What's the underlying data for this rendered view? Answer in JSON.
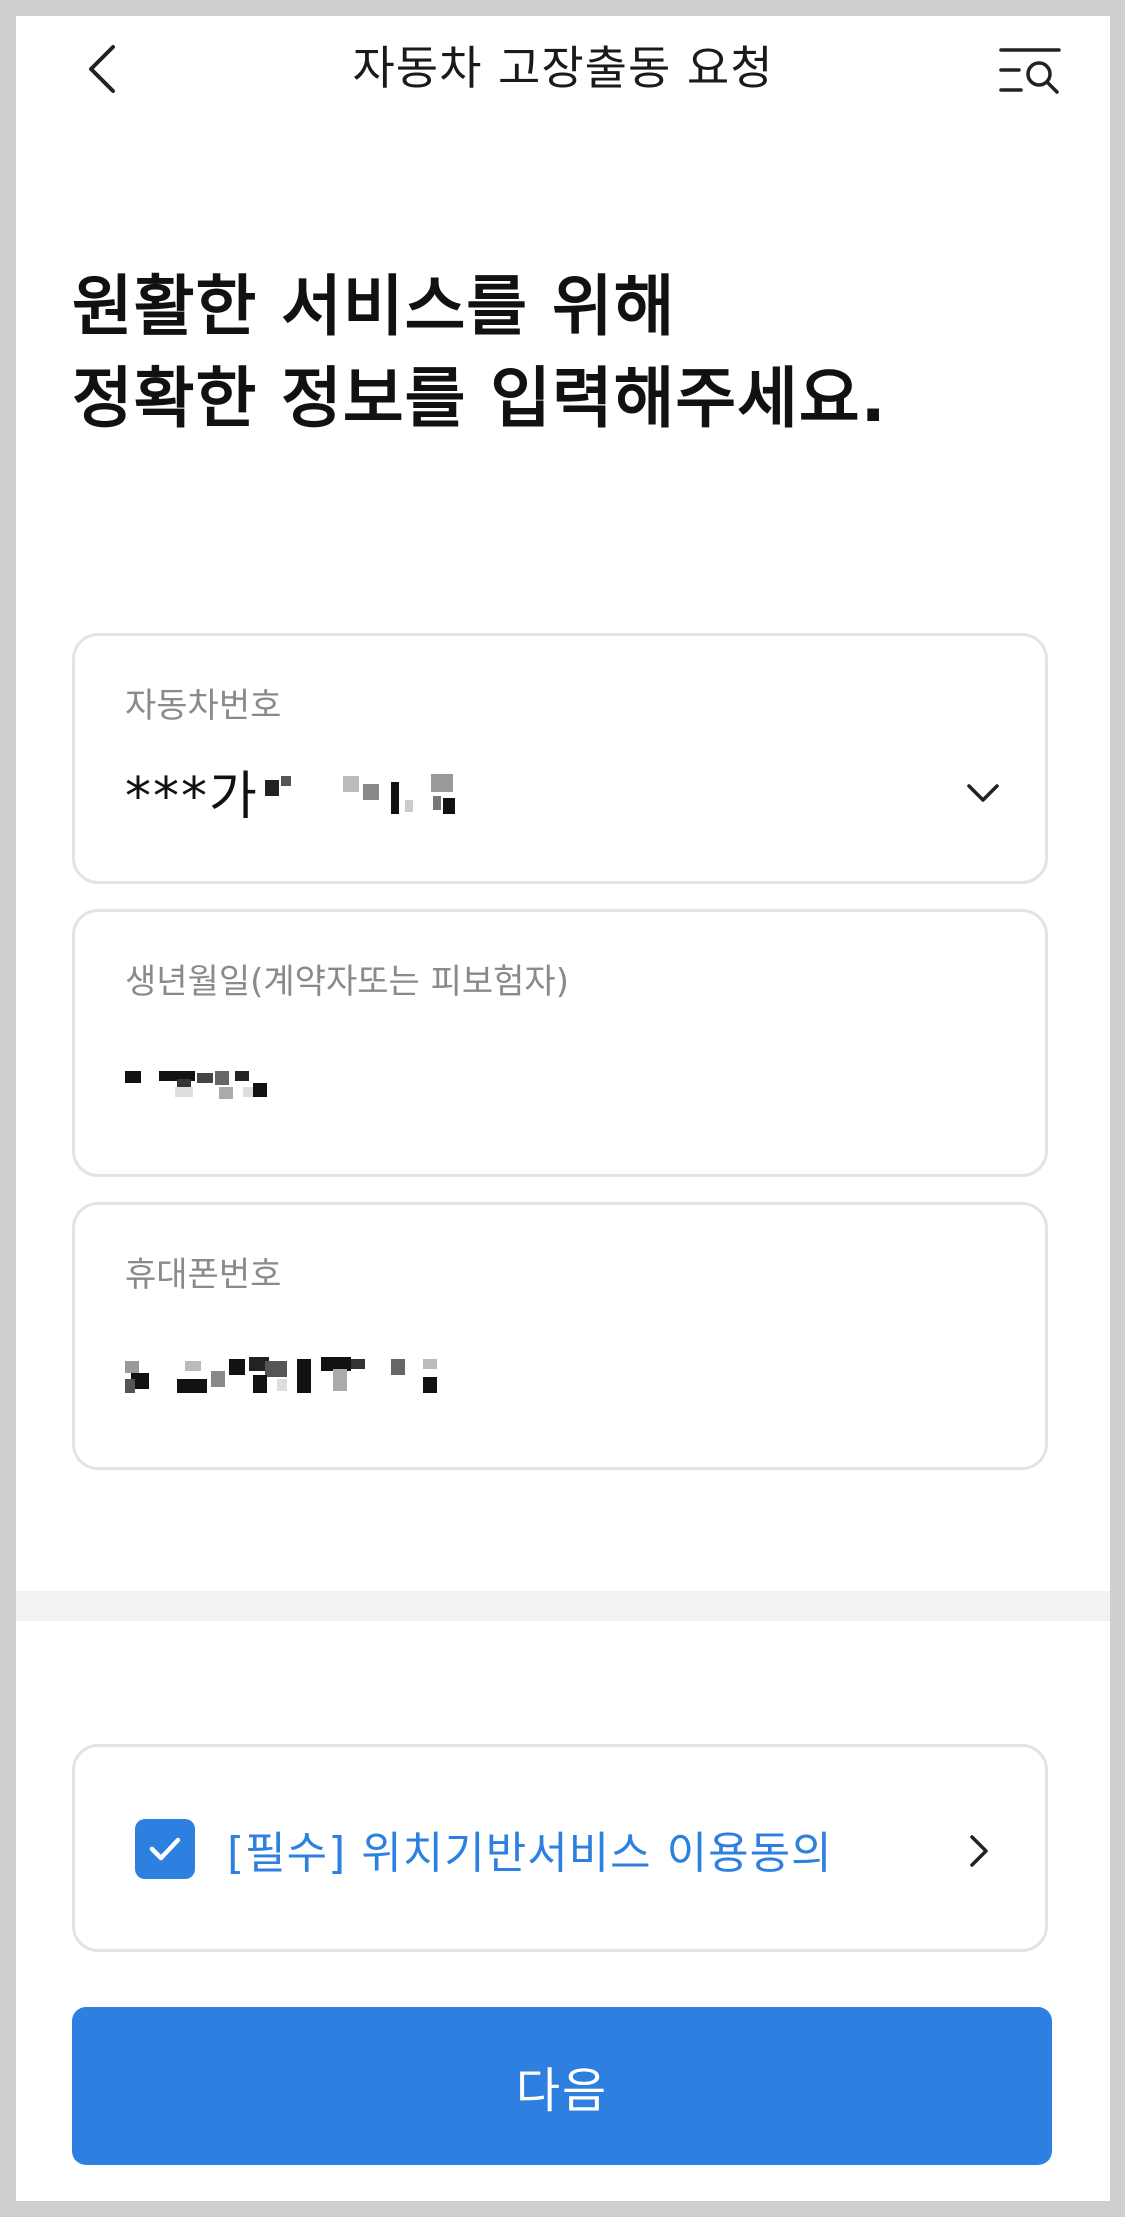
{
  "header": {
    "title": "자동차 고장출동 요청",
    "back_icon": "chevron-left-icon",
    "menu_icon": "menu-search-icon"
  },
  "heading": {
    "line1": "원활한 서비스를 위해",
    "line2": "정확한 정보를 입력해주세요."
  },
  "fields": {
    "car_number": {
      "label": "자동차번호",
      "value_visible": "***가",
      "masked": true
    },
    "birth_date": {
      "label": "생년월일(계약자또는 피보험자)",
      "masked": true
    },
    "phone": {
      "label": "휴대폰번호",
      "masked": true
    }
  },
  "consent": {
    "label": "[필수] 위치기반서비스 이용동의",
    "checked": true
  },
  "next_button": {
    "label": "다음"
  },
  "colors": {
    "accent": "#2d7fe0",
    "label_gray": "#8a8a8a",
    "border": "#e3e3e3",
    "divider": "#f1f2f4"
  }
}
